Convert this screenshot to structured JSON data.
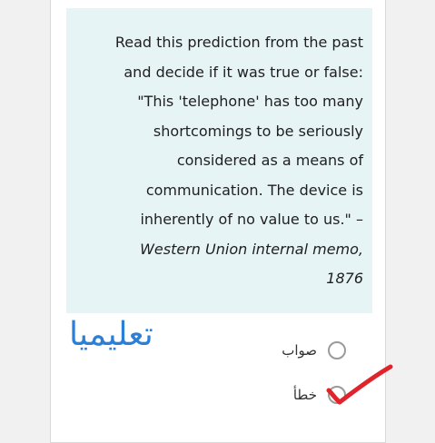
{
  "question": {
    "lines": [
      "Read this prediction from the past",
      "and decide if it was true or false:",
      "\"This 'telephone' has too many",
      "shortcomings to be seriously",
      "considered as a means of",
      "communication. The device is",
      "inherently of no value to us.\" –"
    ],
    "citation_lines": [
      "Western Union internal memo,",
      "1876"
    ]
  },
  "watermark": "تعليميا",
  "options": [
    {
      "label": "صواب"
    },
    {
      "label": "خطأ"
    }
  ],
  "colors": {
    "question_bg": "#e7f4f6",
    "watermark": "#2b7fd6",
    "check": "#e0242b"
  }
}
